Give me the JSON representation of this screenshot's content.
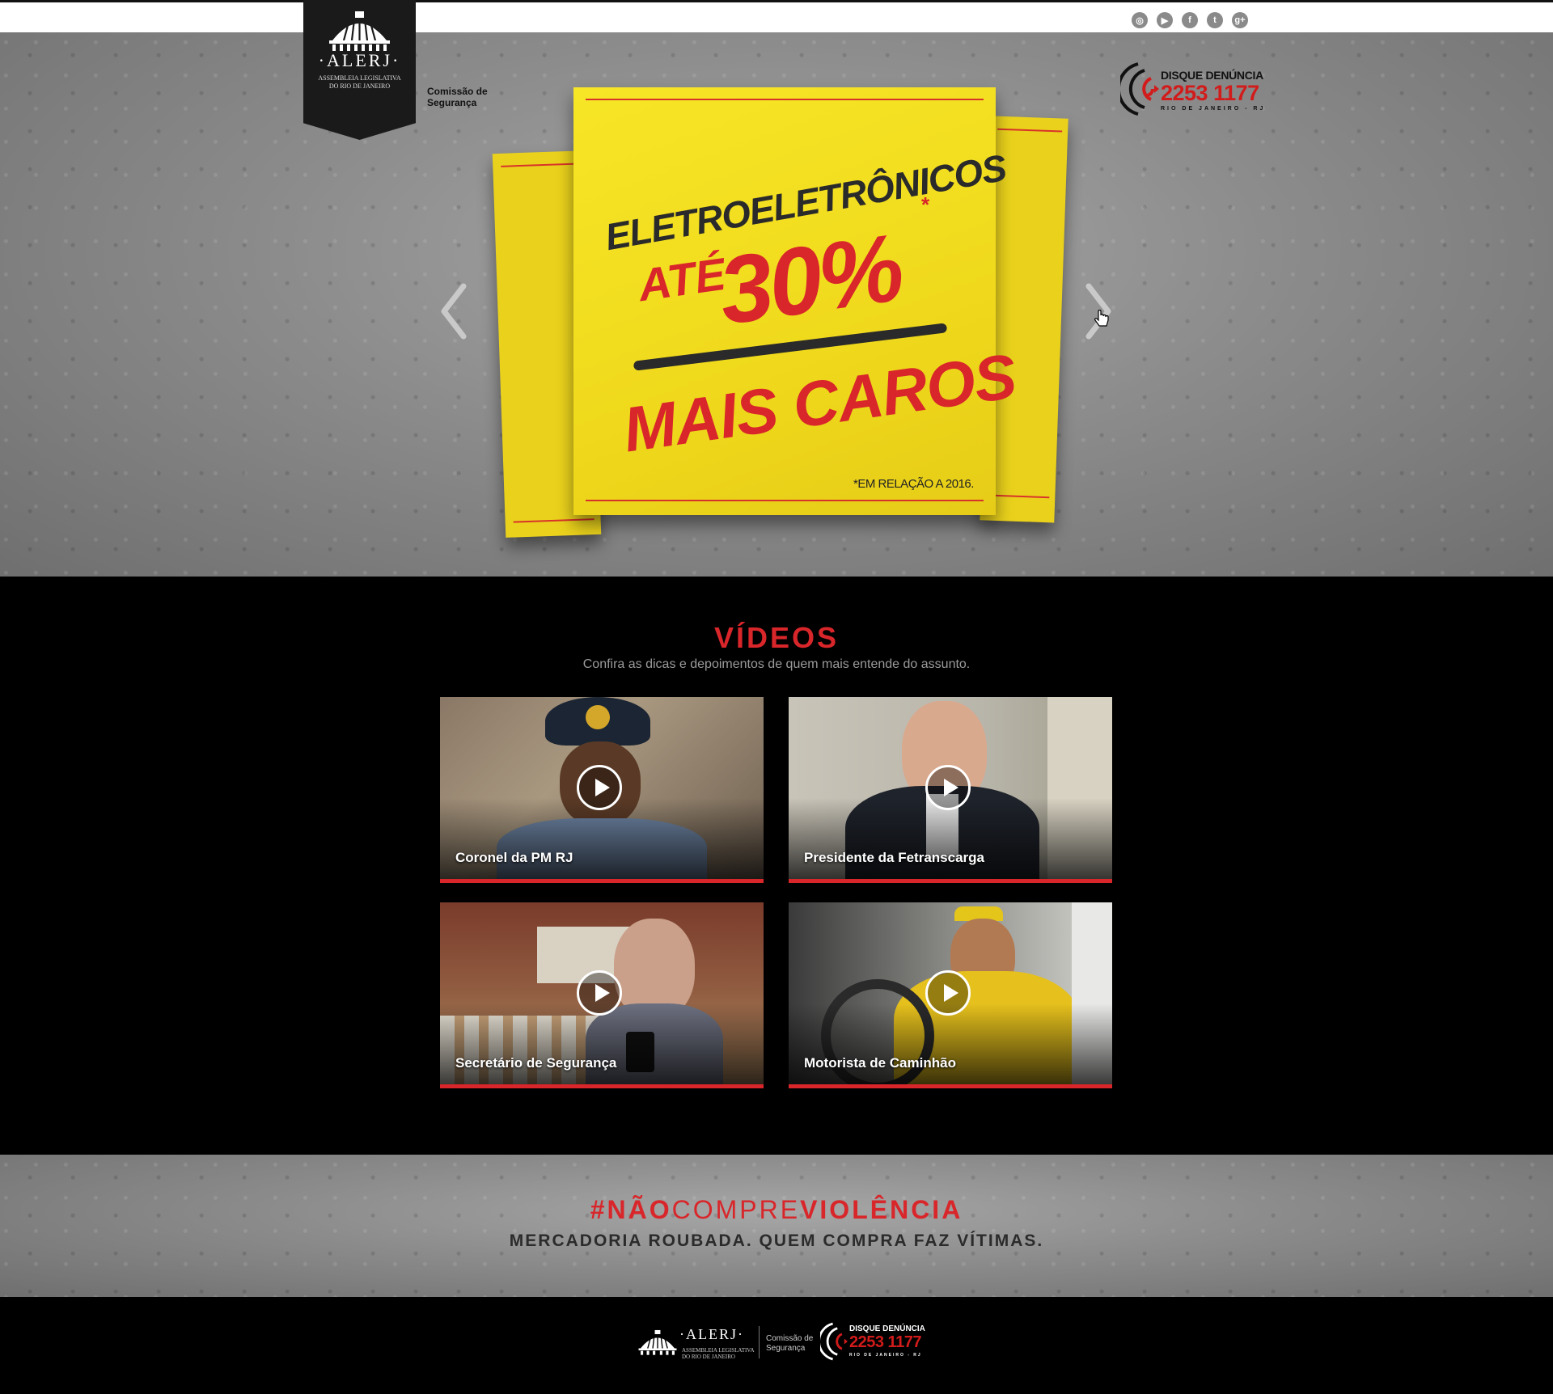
{
  "header": {
    "social": [
      {
        "name": "instagram",
        "glyph": "◎"
      },
      {
        "name": "youtube",
        "glyph": "▶"
      },
      {
        "name": "facebook",
        "glyph": "f"
      },
      {
        "name": "twitter",
        "glyph": "t"
      },
      {
        "name": "google-plus",
        "glyph": "g+"
      }
    ],
    "logo": {
      "name": "·ALERJ·",
      "subtitle_1": "ASSEMBLEIA LEGISLATIVA",
      "subtitle_2": "DO RIO DE JANEIRO"
    },
    "comissao_1": "Comissão de",
    "comissao_2": "Segurança",
    "disque": {
      "title": "DISQUE DENÚNCIA",
      "number": "2253 1177",
      "city": "RIO DE JANEIRO - RJ"
    }
  },
  "hero": {
    "line1": "ELETROELETRÔNICOS",
    "line2a": "ATÉ",
    "line2b": "30%",
    "asterisk": "*",
    "line3": "MAIS CAROS",
    "footnote": "*EM RELAÇÃO A 2016."
  },
  "videos": {
    "title": "VÍDEOS",
    "subtitle": "Confira as dicas e depoimentos de quem mais entende do assunto.",
    "items": [
      {
        "label": "Coronel da PM RJ"
      },
      {
        "label": "Presidente da Fetranscarga"
      },
      {
        "label": "Secretário de Segurança"
      },
      {
        "label": "Motorista de Caminhão"
      }
    ]
  },
  "campaign": {
    "hash": "#",
    "word1": "NÃO",
    "word2": "COMPRE",
    "word3": "VIOLÊNCIA",
    "tagline": "MERCADORIA ROUBADA. QUEM COMPRA FAZ VÍTIMAS."
  },
  "footer": {
    "logo_name": "·ALERJ·",
    "logo_sub_1": "ASSEMBLEIA LEGISLATIVA",
    "logo_sub_2": "DO RIO DE JANEIRO",
    "comissao_1": "Comissão de",
    "comissao_2": "Segurança",
    "disque_title": "DISQUE DENÚNCIA",
    "disque_number": "2253 1177",
    "disque_city": "RIO DE JANEIRO - RJ"
  },
  "colors": {
    "accent_red": "#d8262a",
    "sticky_yellow": "#f2db1a",
    "footer_bg": "#000000"
  }
}
